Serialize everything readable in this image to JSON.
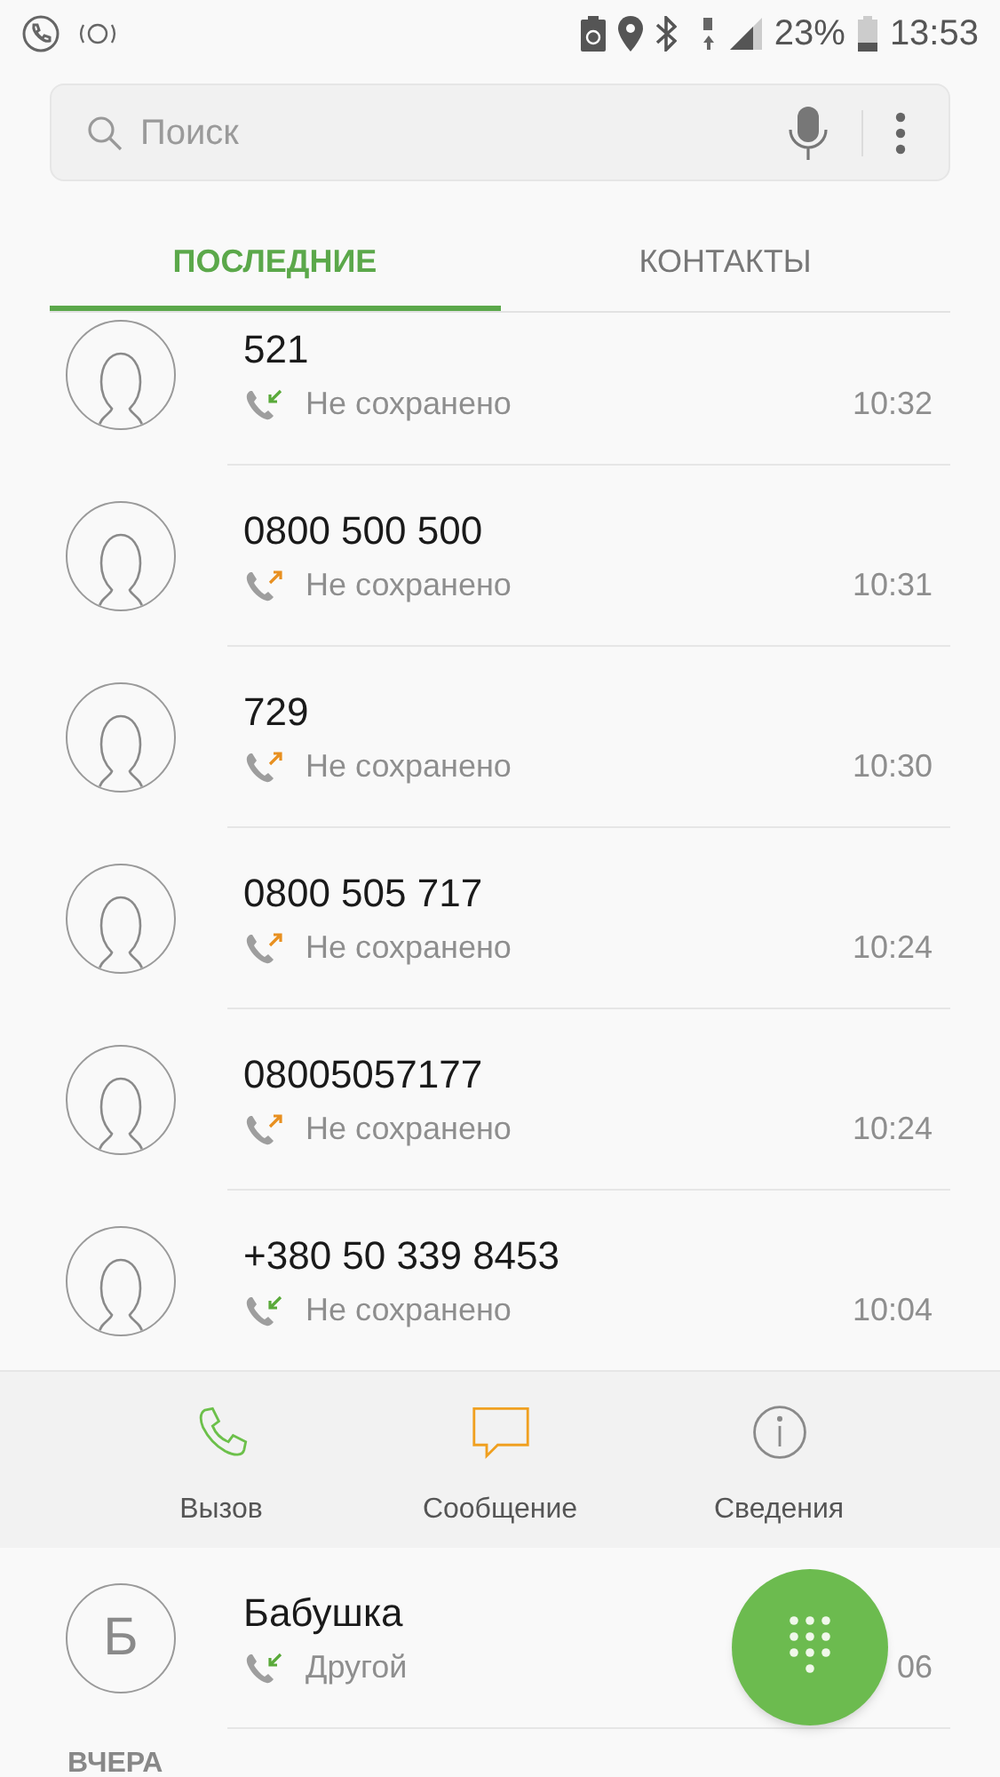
{
  "status_bar": {
    "battery_percent": "23%",
    "time": "13:53"
  },
  "search": {
    "placeholder": "Поиск"
  },
  "tabs": [
    {
      "label": "ПОСЛЕДНИЕ",
      "selected": true
    },
    {
      "label": "КОНТАКТЫ",
      "selected": false
    }
  ],
  "calls": [
    {
      "name": "521",
      "kind": "incoming",
      "status": "Не сохранено",
      "time": "10:32"
    },
    {
      "name": "0800 500 500",
      "kind": "outgoing",
      "status": "Не сохранено",
      "time": "10:31"
    },
    {
      "name": "729",
      "kind": "outgoing",
      "status": "Не сохранено",
      "time": "10:30"
    },
    {
      "name": "0800 505 717",
      "kind": "outgoing",
      "status": "Не сохранено",
      "time": "10:24"
    },
    {
      "name": "08005057177",
      "kind": "outgoing",
      "status": "Не сохранено",
      "time": "10:24"
    },
    {
      "name": "+380 50 339 8453",
      "kind": "incoming",
      "status": "Не сохранено",
      "time": "10:04",
      "actions": [
        {
          "kind": "call",
          "label": "Вызов"
        },
        {
          "kind": "message",
          "label": "Сообщение"
        },
        {
          "kind": "info",
          "label": "Сведения"
        }
      ]
    },
    {
      "name": "Бабушка",
      "initial": "Б",
      "kind": "incoming",
      "status": "Другой",
      "time": "06"
    }
  ],
  "section_header": "ВЧЕРА"
}
